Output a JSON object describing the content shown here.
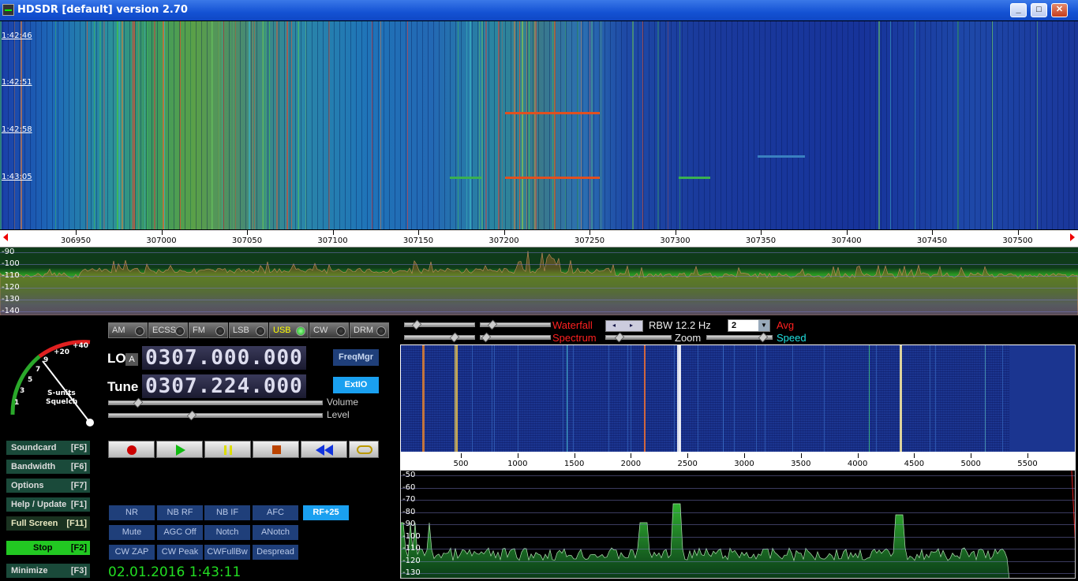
{
  "window": {
    "title": "HDSDR [default]  version 2.70"
  },
  "waterfall": {
    "timestamps": [
      "1:42:46",
      "1:42:51",
      "1:42:58",
      "1:43:05"
    ]
  },
  "freq_axis": {
    "labels": [
      "306950",
      "307000",
      "307050",
      "307100",
      "307150",
      "307200",
      "307250",
      "307300",
      "307350",
      "307400",
      "307450",
      "307500"
    ]
  },
  "spectrum": {
    "db_labels": [
      "-90",
      "-100",
      "-110",
      "-120",
      "-130",
      "-140"
    ]
  },
  "smeter": {
    "scale": [
      "1",
      "3",
      "5",
      "7",
      "9",
      "+20",
      "+40"
    ],
    "caption_line1": "S-units",
    "caption_line2": "Squelch"
  },
  "modes": [
    {
      "label": "AM",
      "active": false
    },
    {
      "label": "ECSS",
      "active": false
    },
    {
      "label": "FM",
      "active": false
    },
    {
      "label": "LSB",
      "active": false
    },
    {
      "label": "USB",
      "active": true
    },
    {
      "label": "CW",
      "active": false
    },
    {
      "label": "DRM",
      "active": false
    }
  ],
  "lo": {
    "label": "LO",
    "badge": "A",
    "value": "0307.000.000"
  },
  "tune": {
    "label": "Tune",
    "value": "0307.224.000"
  },
  "buttons": {
    "freqmgr": "FreqMgr",
    "extio": "ExtIO"
  },
  "sliders": {
    "volume": "Volume",
    "level": "Level"
  },
  "side_buttons": [
    {
      "label": "Soundcard",
      "key": "[F5]"
    },
    {
      "label": "Bandwidth",
      "key": "[F6]"
    },
    {
      "label": "Options",
      "key": "[F7]"
    },
    {
      "label": "Help / Update",
      "key": "[F1]"
    },
    {
      "label": "Full Screen",
      "key": "[F11]"
    },
    {
      "label": "Stop",
      "key": "[F2]"
    },
    {
      "label": "Minimize",
      "key": "[F3]"
    }
  ],
  "dsp_buttons": [
    [
      "NR",
      "NB RF",
      "NB IF",
      "AFC",
      "RF+25"
    ],
    [
      "Mute",
      "AGC Off",
      "Notch",
      "ANotch"
    ],
    [
      "CW ZAP",
      "CW Peak",
      "CWFullBw",
      "Despread"
    ]
  ],
  "datetime": "02.01.2016 1:43:11",
  "zoom_controls": {
    "waterfall": "Waterfall",
    "spectrum": "Spectrum",
    "rbw": "RBW 12.2 Hz",
    "avg_value": "2",
    "avg": "Avg",
    "zoom": "Zoom",
    "speed": "Speed"
  },
  "zoom_axis": {
    "labels": [
      "500",
      "1000",
      "1500",
      "2000",
      "2500",
      "3000",
      "3500",
      "4000",
      "4500",
      "5000",
      "5500"
    ]
  },
  "zoom_spectrum": {
    "db_labels": [
      "-50",
      "-60",
      "-70",
      "-80",
      "-90",
      "-100",
      "-110",
      "-120",
      "-130"
    ]
  },
  "colors": {
    "titlebar": "#1452d4",
    "active_button": "#1aa0f0",
    "stop_button": "#22c822",
    "datetime": "#22dd22",
    "waterfall_label": "#ff2020",
    "speed_label": "#20e0e0"
  }
}
